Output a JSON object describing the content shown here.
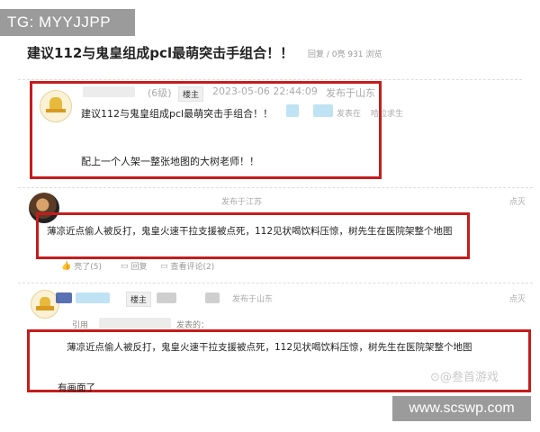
{
  "overlay_tag": "TG: MYYJJPP",
  "post": {
    "title": "建议112与鬼皇组成pcl最萌突击手组合！！",
    "stats": "回复 / 0亮 931 浏览"
  },
  "floor1": {
    "level": "(6级)",
    "badge": "楼主",
    "datetime": "2023-05-06 22:44:09",
    "location": "发布于山东",
    "sender": "发表在",
    "sender2": "哈拉求生",
    "line1": "建议112与鬼皇组成pcl最萌突击手组合！！",
    "line2": "配上一个人架一整张地图的大树老师！！"
  },
  "floor2": {
    "location": "发布于江苏",
    "corner": "点灭",
    "text": "薄凉近点偷人被反打，鬼皇火速干拉支援被点死，112见状喝饮料压惊，树先生在医院架整个地图",
    "actions": [
      "亮了(5)",
      "回复",
      "查看评论(2)"
    ]
  },
  "floor3": {
    "badge": "楼主",
    "location": "发布于山东",
    "corner": "点灭",
    "quote_label": "引用",
    "quote_suffix": "发表的：",
    "text": "薄凉近点偷人被反打，鬼皇火速干拉支援被点死，112见状喝饮料压惊，树先生在医院架整个地图",
    "reply": "有画面了"
  },
  "watermark": "⊙@叁首游戏",
  "site_tag": "www.scswp.com",
  "colors": {
    "highlight_border": "#c61c1c",
    "tag_background": "#9b9b9b"
  }
}
